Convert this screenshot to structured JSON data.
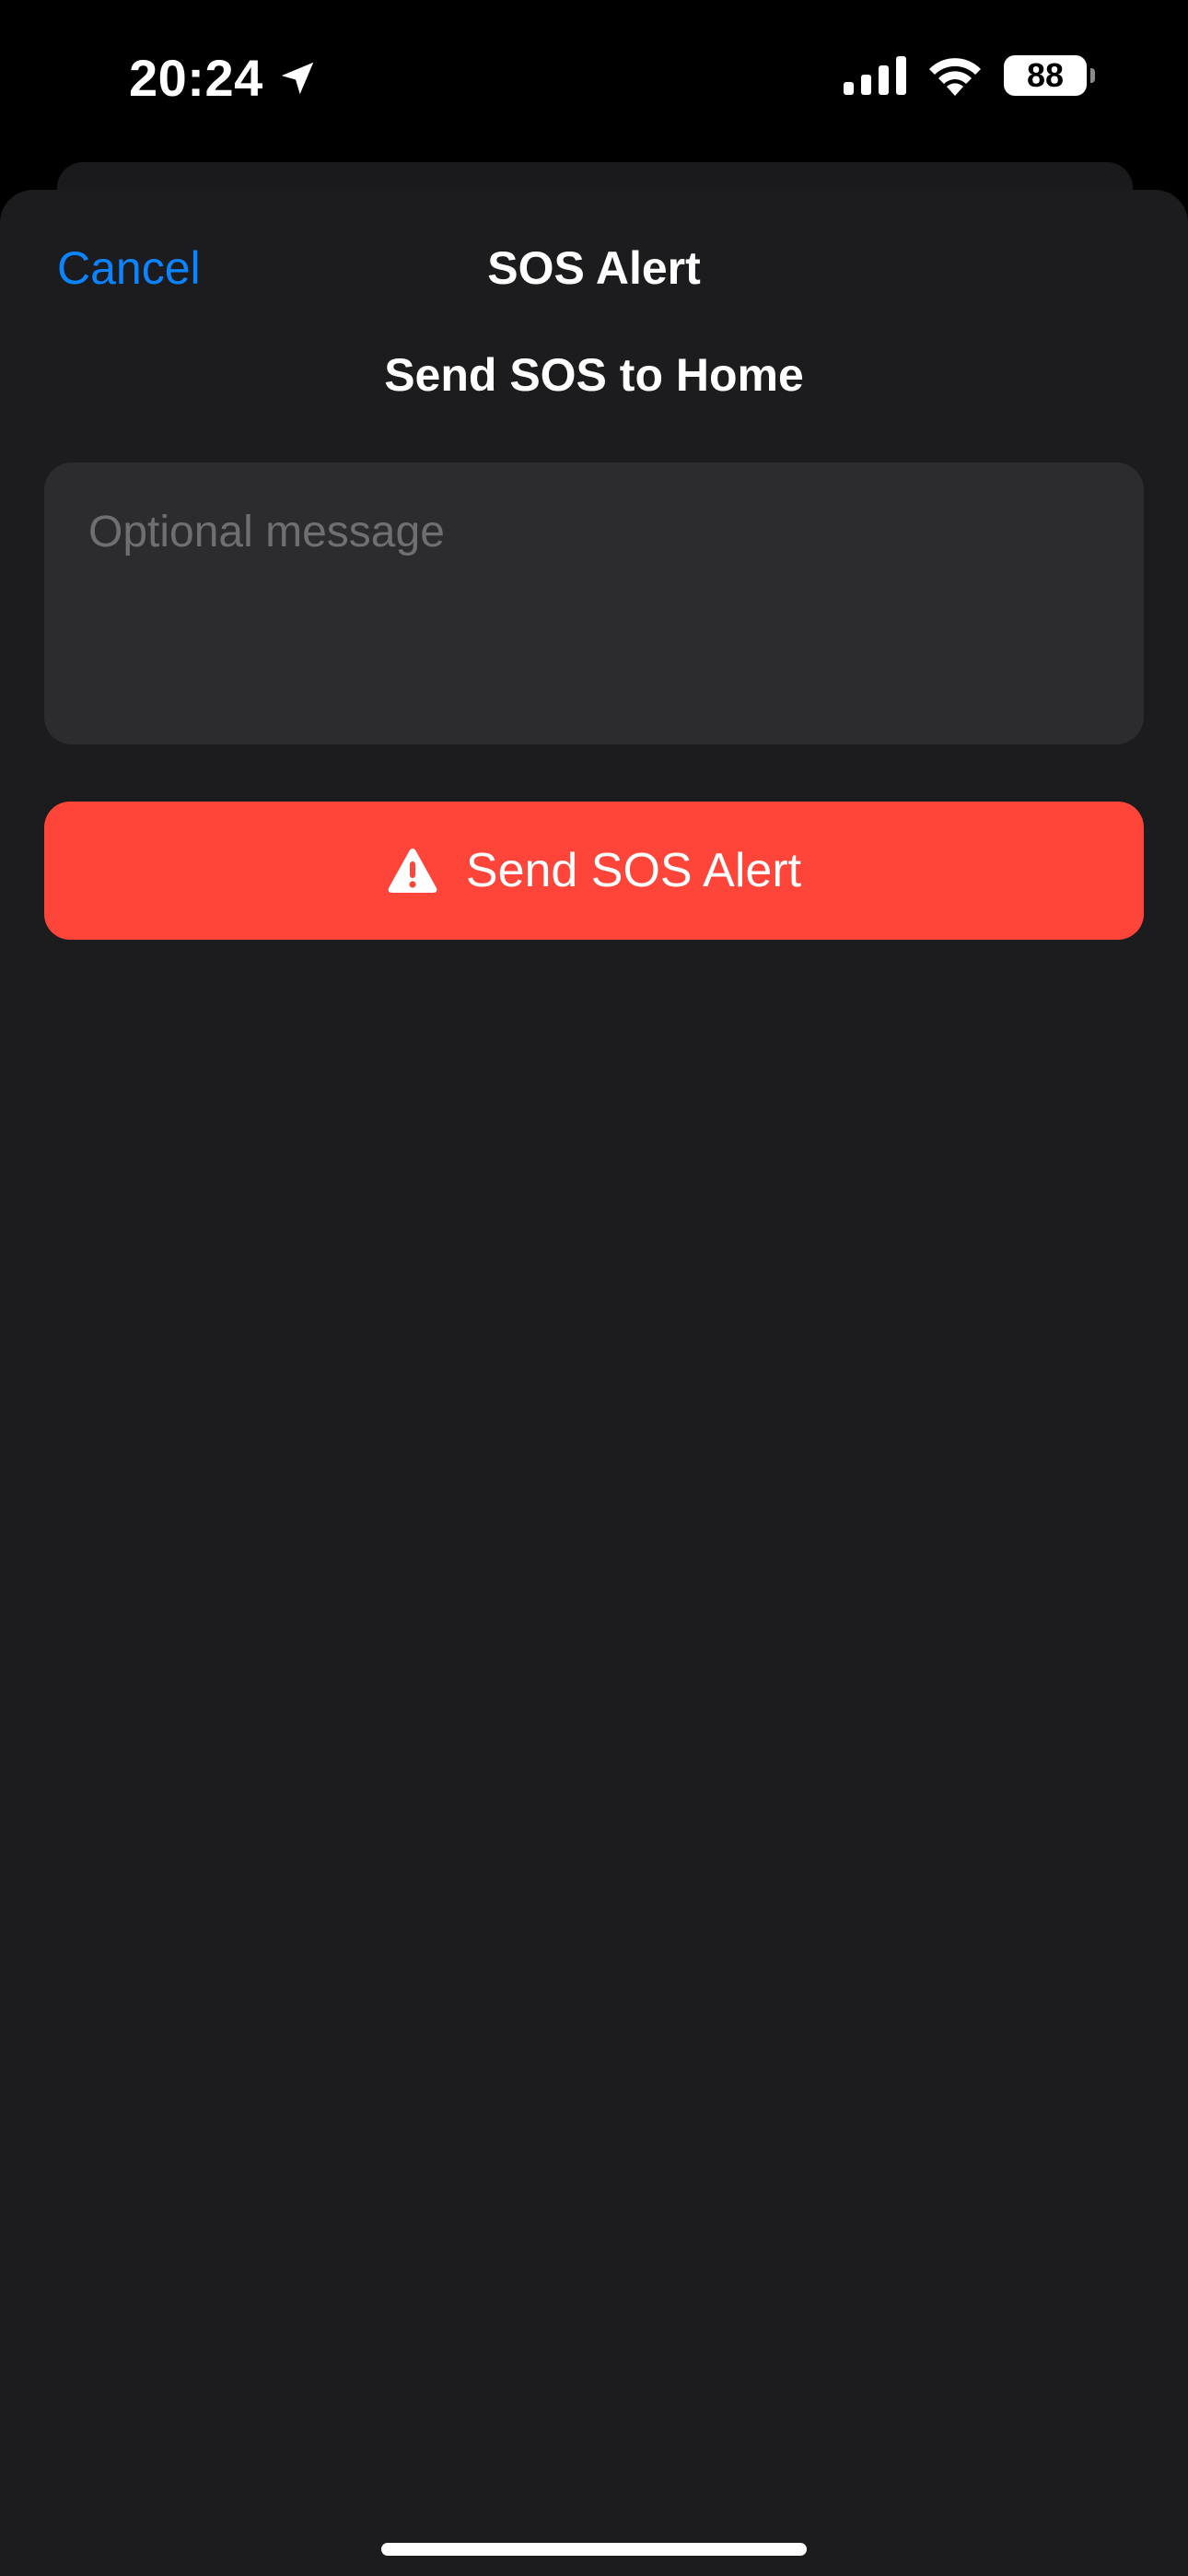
{
  "status_bar": {
    "time": "20:24",
    "battery": "88",
    "icons": [
      "location-arrow-icon",
      "cellular-signal-icon",
      "wifi-icon",
      "battery-icon"
    ]
  },
  "sheet": {
    "cancel_label": "Cancel",
    "title": "SOS Alert",
    "subtitle": "Send SOS to Home",
    "message_placeholder": "Optional message",
    "message_value": "",
    "send_button_label": "Send SOS Alert",
    "send_button_icon": "warning-triangle-icon"
  },
  "colors": {
    "accent": "#0a84ff",
    "danger": "#ff453a",
    "sheet_background": "#1c1c1e",
    "field_background": "#2c2c2e"
  }
}
